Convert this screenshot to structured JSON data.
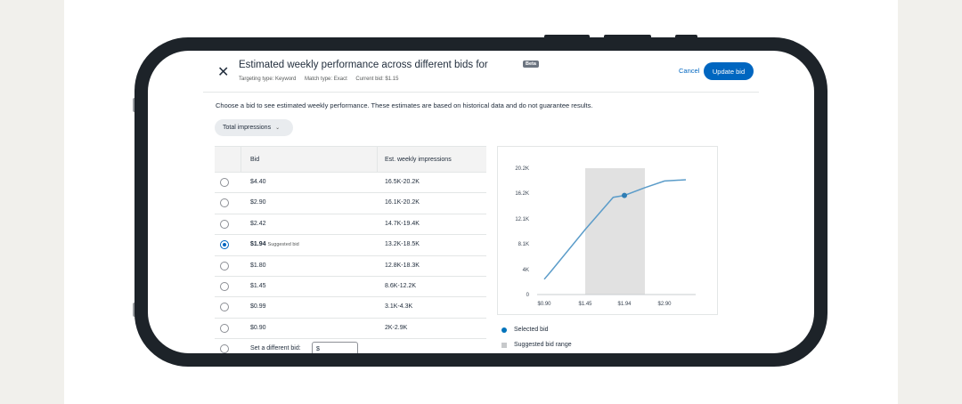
{
  "modal": {
    "title": "Estimated weekly performance across different bids for",
    "beta": "Beta",
    "meta": {
      "targeting": "Targeting type: Keyword",
      "match": "Match type: Exact",
      "current_bid": "Current bid: $1.15"
    },
    "close_label": "✕",
    "cancel_label": "Cancel",
    "update_label": "Update bid"
  },
  "description": "Choose a bid to see estimated weekly performance. These estimates are based on historical data and do not guarantee results.",
  "metric_dropdown": {
    "selected": "Total impressions",
    "chevron": "⌄"
  },
  "table": {
    "headers": {
      "bid": "Bid",
      "impressions": "Est. weekly impressions"
    },
    "rows": [
      {
        "bid": "$4.40",
        "impressions": "16.5K-20.2K",
        "selected": false,
        "suggested": ""
      },
      {
        "bid": "$2.90",
        "impressions": "16.1K-20.2K",
        "selected": false,
        "suggested": ""
      },
      {
        "bid": "$2.42",
        "impressions": "14.7K-19.4K",
        "selected": false,
        "suggested": ""
      },
      {
        "bid": "$1.94",
        "impressions": "13.2K-18.5K",
        "selected": true,
        "suggested": "Suggested bid"
      },
      {
        "bid": "$1.80",
        "impressions": "12.8K-18.3K",
        "selected": false,
        "suggested": ""
      },
      {
        "bid": "$1.45",
        "impressions": "8.6K-12.2K",
        "selected": false,
        "suggested": ""
      },
      {
        "bid": "$0.99",
        "impressions": "3.1K-4.3K",
        "selected": false,
        "suggested": ""
      },
      {
        "bid": "$0.90",
        "impressions": "2K-2.9K",
        "selected": false,
        "suggested": ""
      }
    ],
    "custom_bid": {
      "label": "Set a different bid:",
      "value": "$"
    }
  },
  "chart_data": {
    "type": "line",
    "y_ticks": [
      "20.2K",
      "16.2K",
      "12.1K",
      "8.1K",
      "4K",
      "0"
    ],
    "y_tick_values": [
      20200,
      16200,
      12100,
      8100,
      4000,
      0
    ],
    "x_ticks": [
      "$0.90",
      "$1.45",
      "$1.94",
      "$2.90"
    ],
    "ylim": [
      0,
      20200
    ],
    "x_bids": [
      0.9,
      0.99,
      1.45,
      1.8,
      1.94,
      2.42,
      2.9,
      4.4
    ],
    "y_values": [
      2450,
      3700,
      10400,
      15550,
      15850,
      17050,
      18150,
      18350
    ],
    "suggested_range": [
      1.45,
      2.42
    ],
    "selected_bid": 1.94,
    "colors": {
      "line": "#5b9cc9",
      "selected": "#2f7eb5",
      "range": "#e1e1e1",
      "axis": "#c9cccf"
    },
    "legend": [
      "Selected bid",
      "Suggested bid range"
    ]
  }
}
